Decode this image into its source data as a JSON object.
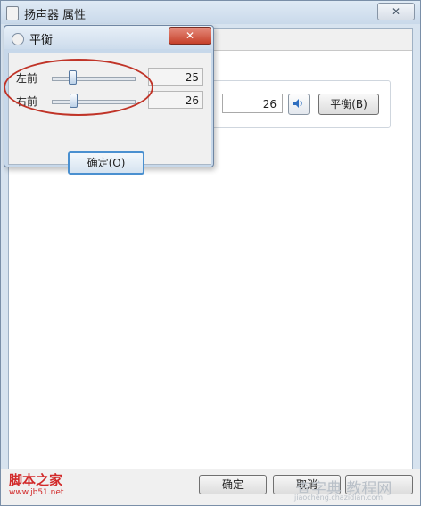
{
  "main_window": {
    "title": "扬声器 属性",
    "close_label": "✕",
    "level_value": "26",
    "balance_button": "平衡(B)",
    "buttons": {
      "ok": "确定",
      "cancel": "取消",
      "apply": ""
    }
  },
  "balance_dialog": {
    "title": "平衡",
    "close_label": "✕",
    "channels": [
      {
        "label": "左前",
        "value": "25",
        "level": 0.25
      },
      {
        "label": "右前",
        "value": "26",
        "level": 0.26
      }
    ],
    "ok_label": "确定(O)"
  },
  "watermarks": {
    "left": "脚本之家",
    "left_url": "www.jb51.net",
    "right": "查字典 教程网",
    "right_url": "jiaocheng.chazidian.com"
  },
  "colors": {
    "highlight": "#c03428",
    "close_button": "#c6402a"
  }
}
